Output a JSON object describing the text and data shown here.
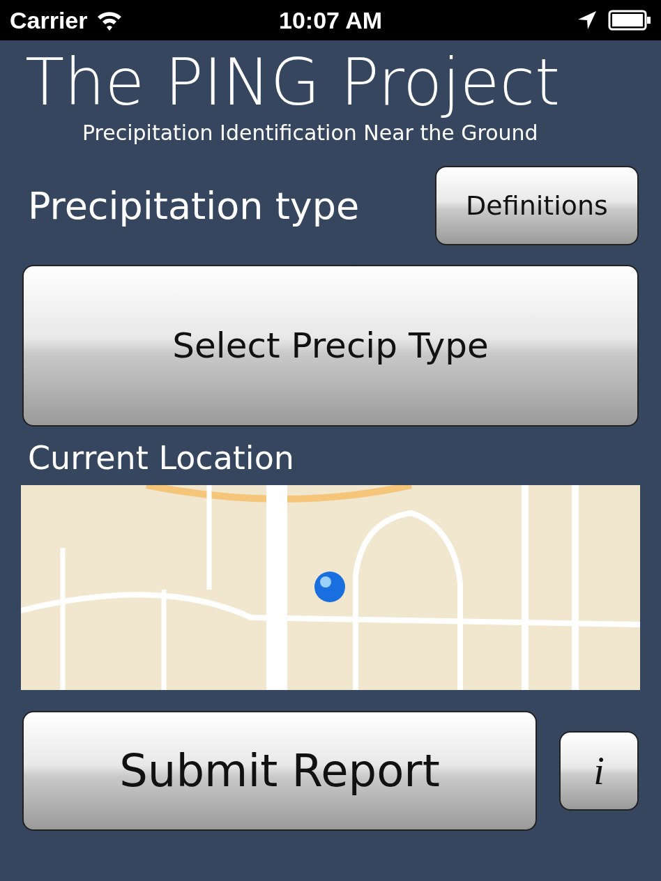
{
  "status_bar": {
    "carrier": "Carrier",
    "time": "10:07 AM"
  },
  "header": {
    "title": "The PING Project",
    "subtitle": "Precipitation Identification Near the Ground"
  },
  "precipitation": {
    "label": "Precipitation type",
    "definitions_button": "Definitions",
    "select_button": "Select Precip Type"
  },
  "location": {
    "label": "Current Location"
  },
  "footer": {
    "submit_button": "Submit Report",
    "info_button": "i"
  }
}
